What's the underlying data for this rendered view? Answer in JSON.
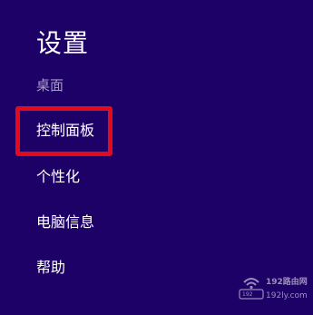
{
  "settings_panel": {
    "title": "设置",
    "section_label": "桌面",
    "items": [
      {
        "label": "控制面板",
        "highlighted": true
      },
      {
        "label": "个性化"
      },
      {
        "label": "电脑信息"
      },
      {
        "label": "帮助"
      }
    ]
  },
  "annotation": {
    "highlight_color": "#e30b1a",
    "icon": "red-outline-box"
  },
  "watermark": {
    "brand": "192路由网",
    "domain": "192ly.com",
    "router_label": "192",
    "icon": "wifi-router-icon"
  },
  "colors": {
    "background": "#1d0166",
    "text": "#ffffff",
    "section_label": "#a79cc9"
  }
}
